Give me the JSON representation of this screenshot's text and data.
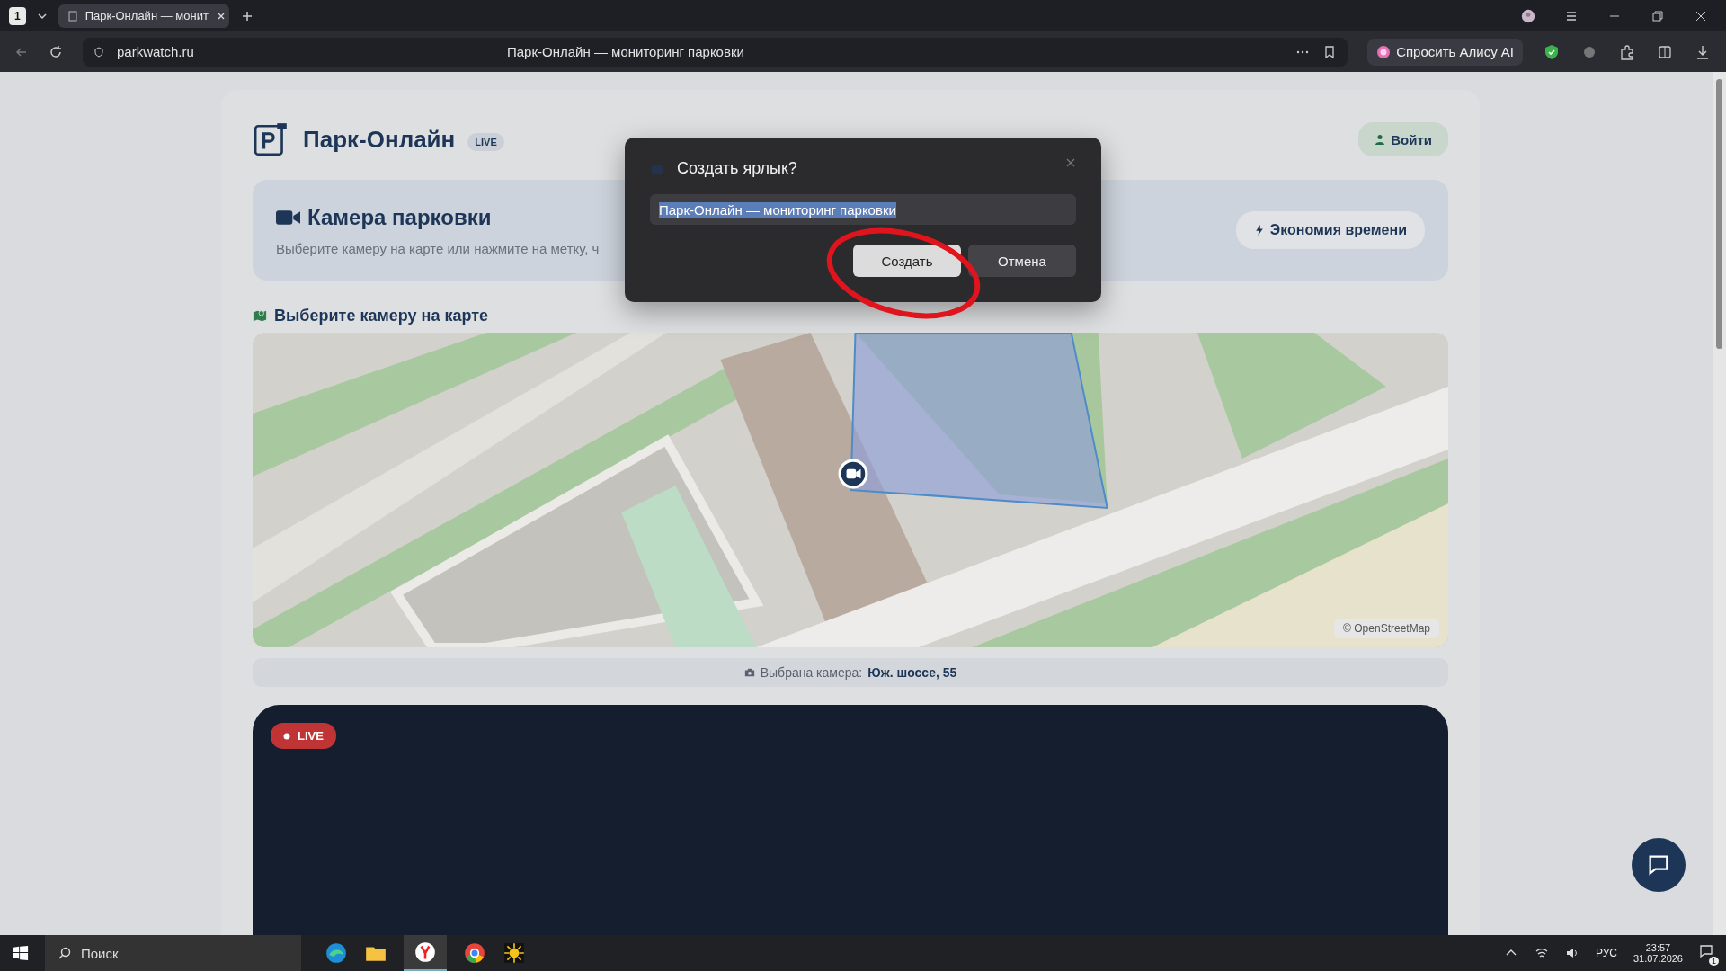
{
  "browser": {
    "tab_counter": "1",
    "tabs": [
      {
        "title": "Парк-Онлайн — монит",
        "selected": true
      }
    ],
    "address": "parkwatch.ru",
    "page_title": "Парк-Онлайн — мониторинг парковки",
    "assistant_button": "Спросить Алису AI"
  },
  "header": {
    "brand": "Парк-Онлайн",
    "badge": "LIVE",
    "login": "Войти"
  },
  "hero": {
    "title": "Камера парковки",
    "subtitle": "Выберите камеру на карте или нажмите на метку, ч",
    "button": "Экономия времени"
  },
  "map": {
    "title": "Выберите камеру на карте",
    "attribution_mark": "©",
    "attribution": "OpenStreetMap"
  },
  "selected_camera": {
    "label": "Выбрана камера:",
    "value": "Юж. шоссе, 55"
  },
  "video": {
    "badge": "LIVE"
  },
  "dialog": {
    "title": "Создать ярлык?",
    "field": {
      "value": "Парк-Онлайн — мониторинг парковки",
      "highlighted": true
    },
    "buttons": [
      {
        "label": "Создать",
        "kind": "primary"
      },
      {
        "label": "Отмена",
        "kind": "secondary"
      }
    ]
  },
  "taskbar": {
    "search_placeholder": "Поиск",
    "language": "РУС",
    "time": "23:57",
    "date": "31.07.2026",
    "notifications": "1"
  }
}
